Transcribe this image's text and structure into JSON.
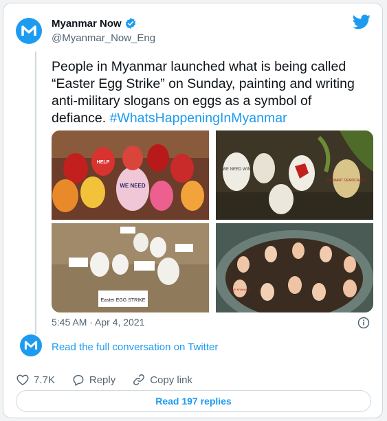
{
  "tweet": {
    "author_name": "Myanmar Now",
    "author_handle": "@Myanmar_Now_Eng",
    "text_main": "People in Myanmar launched what is being called “Easter Egg Strike” on Sunday, painting and writing anti-military slogans on eggs as a symbol of defiance. ",
    "hashtag": "#WhatsHappeningInMyanmar",
    "timestamp": "5:45 AM · Apr 4, 2021",
    "read_conversation": "Read the full conversation on Twitter",
    "likes": "7.7K",
    "reply_label": "Reply",
    "copy_link_label": "Copy link",
    "read_replies": "Read 197 replies"
  },
  "colors": {
    "accent": "#1d9bf0",
    "text": "#0f1419",
    "muted": "#536471",
    "border": "#cfd9de"
  },
  "icons": [
    "myanmar-now-logo-icon",
    "verified-badge-icon",
    "twitter-bird-icon",
    "info-icon",
    "heart-icon",
    "reply-icon",
    "link-icon"
  ],
  "photos": {
    "photo_1": {
      "egg_texts": [
        "WE NEED",
        "HELP"
      ]
    },
    "photo_2": {
      "egg_texts": [
        "WE NEED WIN",
        "WE WANT DEMOCRACY"
      ]
    },
    "photo_3": {
      "sign_text": "Easter EGG STRIKE"
    },
    "photo_4": {
      "egg_texts": [
        "SAVE MYANMAR"
      ]
    }
  }
}
